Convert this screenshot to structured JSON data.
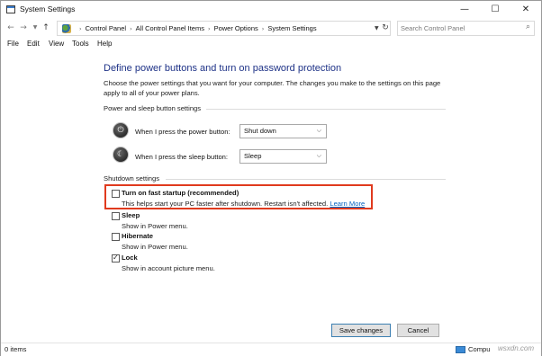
{
  "window": {
    "title": "System Settings",
    "controls": {
      "minimize": "—",
      "maximize": "☐",
      "close": "✕"
    }
  },
  "address": {
    "breadcrumb": [
      "Control Panel",
      "All Control Panel Items",
      "Power Options",
      "System Settings"
    ],
    "search_placeholder": "Search Control Panel"
  },
  "menu": [
    "File",
    "Edit",
    "View",
    "Tools",
    "Help"
  ],
  "content": {
    "heading": "Define power buttons and turn on password protection",
    "intro": "Choose the power settings that you want for your computer. The changes you make to the settings on this page apply to all of your power plans.",
    "power_group": {
      "title": "Power and sleep button settings",
      "rows": [
        {
          "label": "When I press the power button:",
          "value": "Shut down",
          "icon": "power-icon"
        },
        {
          "label": "When I press the sleep button:",
          "value": "Sleep",
          "icon": "sleep-icon"
        }
      ]
    },
    "shutdown_group": {
      "title": "Shutdown settings",
      "options": [
        {
          "title": "Turn on fast startup (recommended)",
          "desc": "This helps start your PC faster after shutdown. Restart isn't affected.",
          "link": "Learn More",
          "checked": false
        },
        {
          "title": "Sleep",
          "desc": "Show in Power menu.",
          "checked": false
        },
        {
          "title": "Hibernate",
          "desc": "Show in Power menu.",
          "checked": false
        },
        {
          "title": "Lock",
          "desc": "Show in account picture menu.",
          "checked": true
        }
      ]
    }
  },
  "buttons": {
    "save": "Save changes",
    "cancel": "Cancel"
  },
  "status": {
    "items": "0 items",
    "zone": "Compu",
    "watermark": "wsxdn.com"
  },
  "colors": {
    "heading": "#1e3287",
    "highlight": "#e03a1e",
    "link": "#0563c1"
  }
}
